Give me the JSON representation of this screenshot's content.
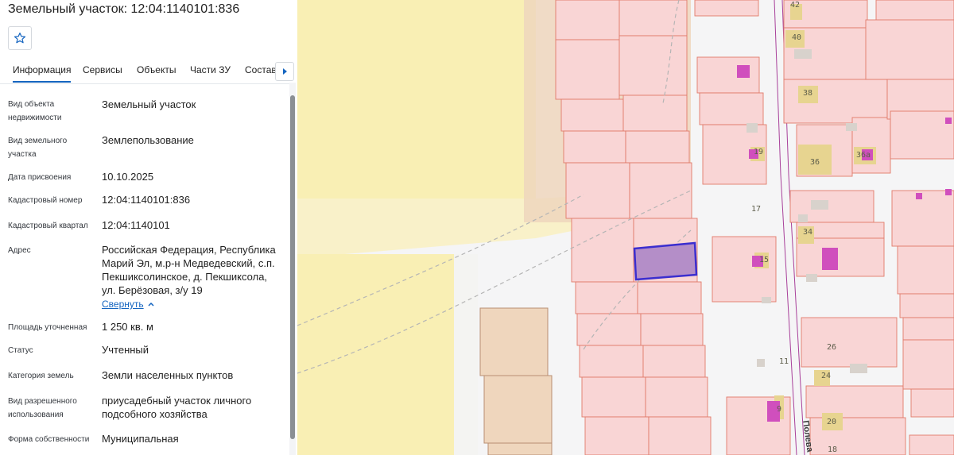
{
  "header": {
    "title": "Земельный участок: 12:04:1140101:836"
  },
  "tabs": [
    {
      "label": "Информация",
      "active": true
    },
    {
      "label": "Сервисы",
      "active": false
    },
    {
      "label": "Объекты",
      "active": false
    },
    {
      "label": "Части ЗУ",
      "active": false
    },
    {
      "label": "Состав",
      "active": false
    }
  ],
  "info": {
    "object_type_label": "Вид объекта недвижимости",
    "object_type_value": "Земельный участок",
    "parcel_type_label": "Вид земельного участка",
    "parcel_type_value": "Землепользование",
    "assigned_date_label": "Дата присвоения",
    "assigned_date_value": "10.10.2025",
    "cadastral_number_label": "Кадастровый номер",
    "cadastral_number_value": "12:04:1140101:836",
    "cadastral_quarter_label": "Кадастровый квартал",
    "cadastral_quarter_value": "12:04:1140101",
    "address_label": "Адрес",
    "address_value": "Российская Федерация, Республика Марий Эл, м.р-н Медведевский, с.п. Пекшиксолинское, д. Пекшиксола, ул. Берёзовая, з/у 19",
    "collapse_label": "Свернуть",
    "area_label": "Площадь уточненная",
    "area_value": "1 250 кв. м",
    "status_label": "Статус",
    "status_value": "Учтенный",
    "category_label": "Категория земель",
    "category_value": "Земли населенных пунктов",
    "permitted_use_label": "Вид разрешенного использования",
    "permitted_use_value": "приусадебный участок личного подсобного хозяйства",
    "ownership_label": "Форма собственности",
    "ownership_value": "Муниципальная"
  },
  "map": {
    "house_numbers": [
      {
        "id": "42",
        "label": "42"
      },
      {
        "id": "40",
        "label": "40"
      },
      {
        "id": "38",
        "label": "38"
      },
      {
        "id": "19",
        "label": "19"
      },
      {
        "id": "36",
        "label": "36"
      },
      {
        "id": "36a",
        "label": "36а"
      },
      {
        "id": "17",
        "label": "17"
      },
      {
        "id": "34",
        "label": "34"
      },
      {
        "id": "15",
        "label": "15"
      },
      {
        "id": "26",
        "label": "26"
      },
      {
        "id": "11",
        "label": "11"
      },
      {
        "id": "24",
        "label": "24"
      },
      {
        "id": "9",
        "label": "9"
      },
      {
        "id": "20",
        "label": "20"
      },
      {
        "id": "18",
        "label": "18"
      }
    ],
    "street_label": "Полева",
    "colors": {
      "parcel_fill": "#f9d5d5",
      "parcel_stroke": "#e07a6a",
      "zone_fill": "#f9efb4",
      "building_fill": "#e7d490",
      "owned_building": "#d04fbd",
      "selected_fill": "#b48ec8",
      "selected_stroke": "#3b2ecf",
      "road_line": "#a8409a",
      "tan_fill": "#efd6bd"
    }
  }
}
